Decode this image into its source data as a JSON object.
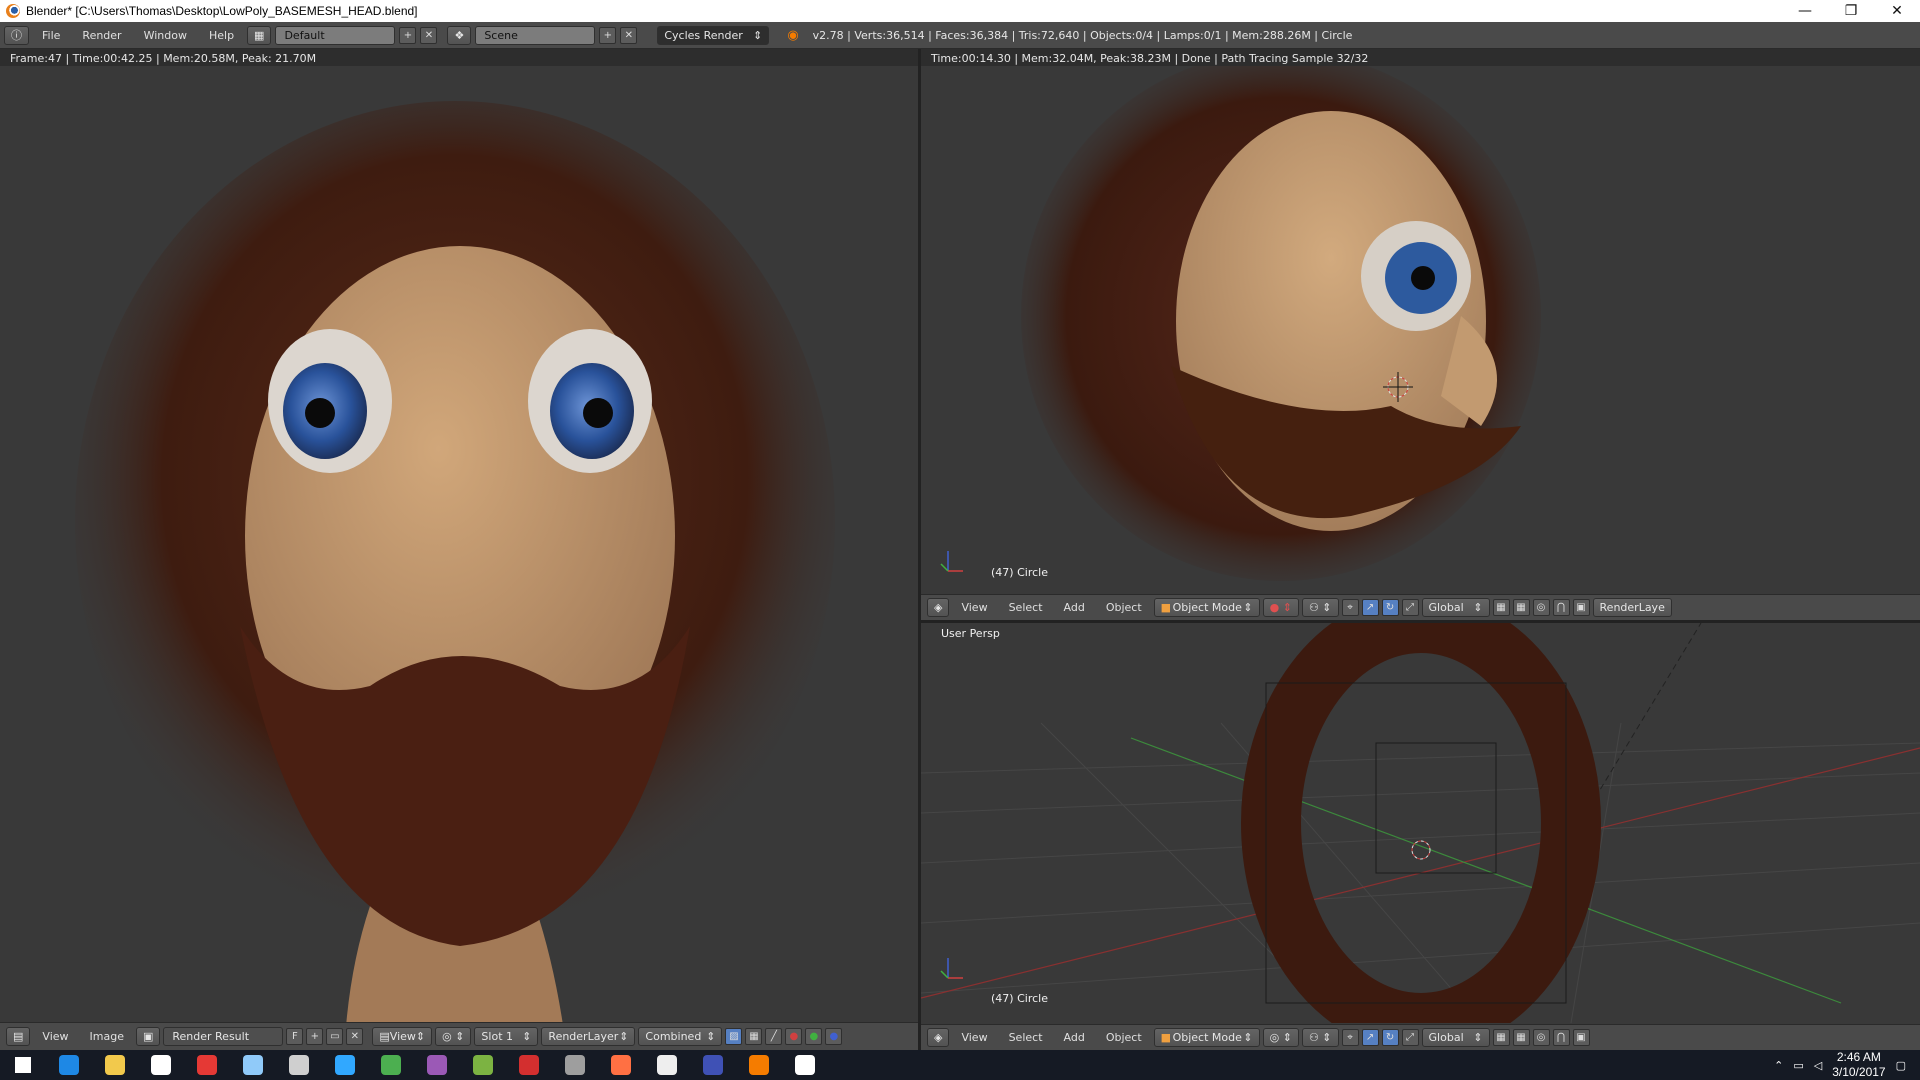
{
  "window": {
    "title": "Blender* [C:\\Users\\Thomas\\Desktop\\LowPoly_BASEMESH_HEAD.blend]",
    "minimize_glyph": "—",
    "restore_glyph": "❐",
    "close_glyph": "✕"
  },
  "info_header": {
    "menus": [
      "File",
      "Render",
      "Window",
      "Help"
    ],
    "screen_layout": "Default",
    "scene": "Scene",
    "render_engine": "Cycles Render",
    "stats": "v2.78 | Verts:36,514 | Faces:36,384 | Tris:72,640 | Objects:0/4 | Lamps:0/1 | Mem:288.26M | Circle"
  },
  "image_editor": {
    "render_info": "Frame:47 | Time:00:42.25 | Mem:20.58M, Peak: 21.70M",
    "footer": {
      "menus": [
        "View",
        "Image"
      ],
      "image_name": "Render Result",
      "fake_user": "F",
      "view_menu": "View",
      "slot": "Slot 1",
      "layer": "RenderLayer",
      "pass": "Combined"
    }
  },
  "viewport_top": {
    "render_info": "Time:00:14.30 | Mem:32.04M, Peak:38.23M | Done | Path Tracing Sample 32/32",
    "object_label": "(47) Circle",
    "footer": {
      "menus": [
        "View",
        "Select",
        "Add",
        "Object"
      ],
      "mode": "Object Mode",
      "orientation": "Global",
      "render_layer": "RenderLaye"
    }
  },
  "viewport_bottom": {
    "view_name": "User Persp",
    "object_label": "(47) Circle",
    "footer": {
      "menus": [
        "View",
        "Select",
        "Add",
        "Object"
      ],
      "mode": "Object Mode",
      "orientation": "Global"
    }
  },
  "taskbar": {
    "apps": [
      {
        "icon": "windows-start-icon",
        "color": "#ffffff"
      },
      {
        "icon": "edge-icon",
        "color": "#1e88e5"
      },
      {
        "icon": "file-explorer-icon",
        "color": "#f2c94c"
      },
      {
        "icon": "store-icon",
        "color": "#ffffff"
      },
      {
        "icon": "chrome-icon",
        "color": "#e53935"
      },
      {
        "icon": "app-tile-icon",
        "color": "#90caf9"
      },
      {
        "icon": "calculator-icon",
        "color": "#cfcfcf"
      },
      {
        "icon": "photoshop-icon",
        "color": "#31a8ff"
      },
      {
        "icon": "dreamweaver-icon",
        "color": "#4caf50"
      },
      {
        "icon": "premiere-icon",
        "color": "#9b59b6"
      },
      {
        "icon": "notepad-icon",
        "color": "#7cb342"
      },
      {
        "icon": "filezilla-icon",
        "color": "#d32f2f"
      },
      {
        "icon": "app-window-icon",
        "color": "#9e9e9e"
      },
      {
        "icon": "firefox-icon",
        "color": "#ff7043"
      },
      {
        "icon": "unity-icon",
        "color": "#eeeeee"
      },
      {
        "icon": "eclipse-icon",
        "color": "#3f51b5"
      },
      {
        "icon": "blender-icon",
        "color": "#f57c00"
      },
      {
        "icon": "photos-icon",
        "color": "#ffffff"
      }
    ],
    "time": "2:46 AM",
    "date": "3/10/2017"
  }
}
